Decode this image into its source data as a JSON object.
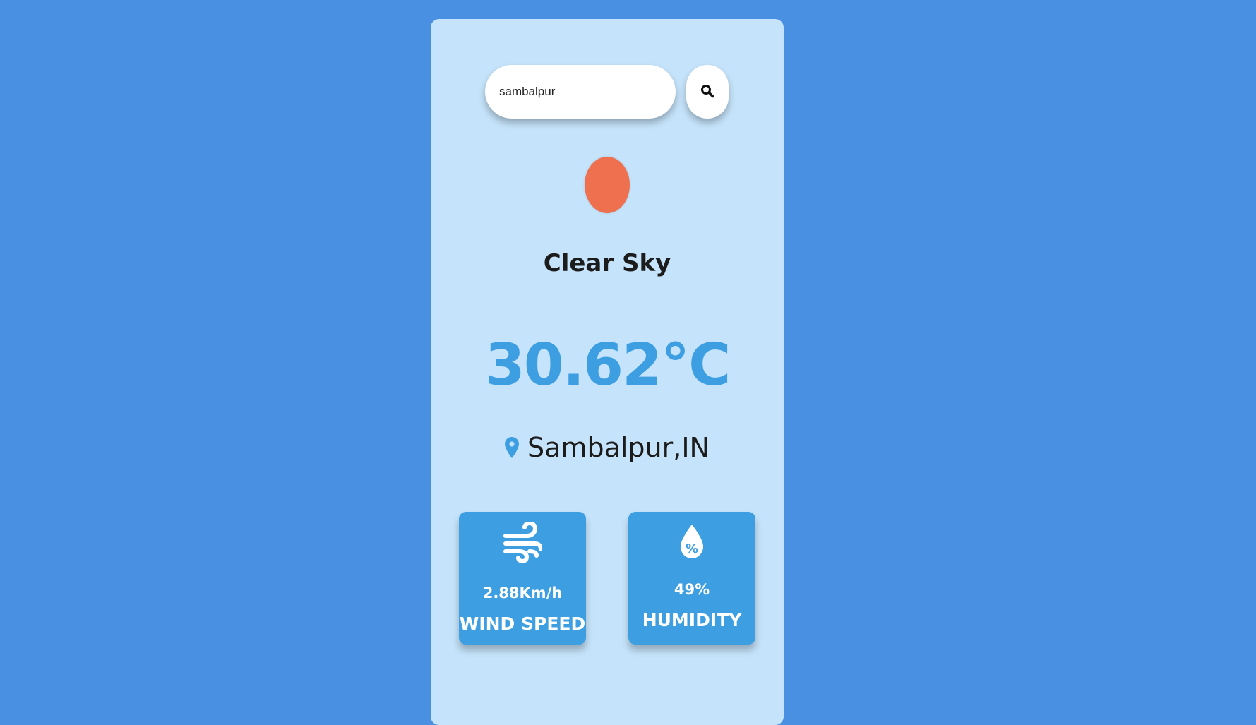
{
  "search": {
    "value": "sambalpur",
    "button_icon": "search-icon"
  },
  "weather": {
    "icon": "sun-icon",
    "icon_color": "#ef704f",
    "condition": "Clear Sky",
    "temperature": "30.62°C",
    "location": "Sambalpur,IN",
    "location_icon": "map-pin-icon"
  },
  "stats": {
    "wind": {
      "icon": "wind-icon",
      "value": "2.88Km/h",
      "label": "WIND SPEED"
    },
    "humidity": {
      "icon": "humidity-drop-icon",
      "value": "49%",
      "label": "HUMIDITY"
    }
  },
  "colors": {
    "page_background": "#4a90e2",
    "card_background": "#c5e3fa",
    "accent": "#3d9fe2",
    "text_dark": "#1c1c1c"
  }
}
